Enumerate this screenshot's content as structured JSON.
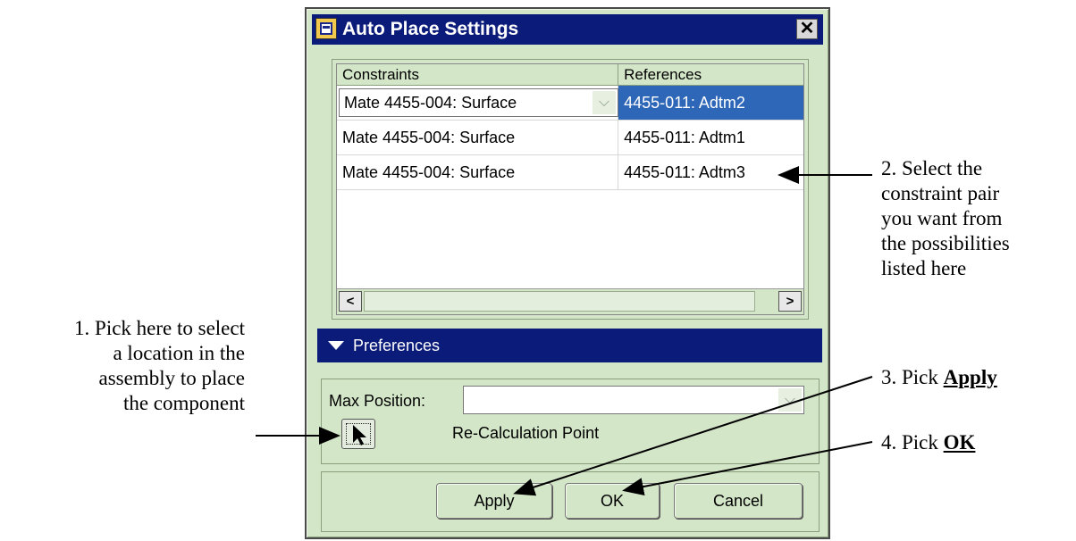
{
  "dialog": {
    "title": "Auto Place Settings",
    "close_label": "✕"
  },
  "table": {
    "headers": [
      "Constraints",
      "References"
    ],
    "rows": [
      {
        "constraint": "Mate  4455-004: Surface",
        "reference": "4455-011: Adtm2",
        "selected": true
      },
      {
        "constraint": "Mate  4455-004: Surface",
        "reference": "4455-011: Adtm1",
        "selected": false
      },
      {
        "constraint": "Mate  4455-004: Surface",
        "reference": "4455-011: Adtm3",
        "selected": false
      }
    ],
    "scroll_left": "<",
    "scroll_right": ">"
  },
  "preferences": {
    "header": "Preferences",
    "max_position_label": "Max Position:",
    "max_position_value": "",
    "recalc_label": "Re-Calculation Point"
  },
  "buttons": {
    "apply": "Apply",
    "ok": "OK",
    "cancel": "Cancel"
  },
  "annotations": {
    "step1": [
      "1. Pick here to select",
      "a location in the",
      "assembly to place",
      "the component"
    ],
    "step2": [
      "2. Select the",
      "constraint pair",
      "you want from",
      "the possibilities",
      "listed here"
    ],
    "step3_prefix": "3. Pick ",
    "step3_bold": "Apply",
    "step4_prefix": "4. Pick ",
    "step4_bold": "OK"
  },
  "colors": {
    "titlebar": "#0b1b7a",
    "dialog_bg": "#d4e6c8",
    "selection": "#2e66b8"
  }
}
